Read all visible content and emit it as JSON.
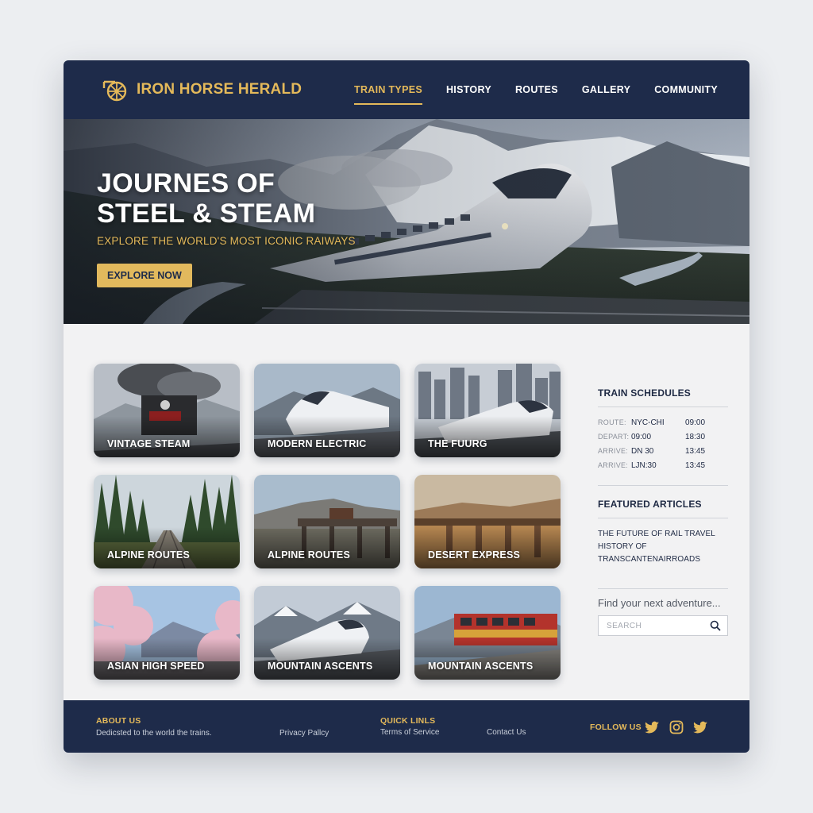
{
  "brand": {
    "name": "IRON HORSE HERALD",
    "logo": "train-wheel-icon"
  },
  "nav": {
    "items": [
      {
        "label": "TRAIN TYPES",
        "active": true
      },
      {
        "label": "HISTORY",
        "active": false
      },
      {
        "label": "ROUTES",
        "active": false
      },
      {
        "label": "GALLERY",
        "active": false
      },
      {
        "label": "COMMUNITY",
        "active": false
      }
    ]
  },
  "hero": {
    "title": "JOURNES OF\nSTEEL & STEAM",
    "subtitle": "EXPLORE THE WORLD'S MOST ICONIC RAIWAYS",
    "cta": "EXPLORE NOW"
  },
  "cards": [
    {
      "label": "VINTAGE STEAM"
    },
    {
      "label": "MODERN ELECTRIC"
    },
    {
      "label": "THE FUURG"
    },
    {
      "label": "ALPINE ROUTES"
    },
    {
      "label": "ALPINE ROUTES"
    },
    {
      "label": "DESERT EXPRESS"
    },
    {
      "label": "ASIAN HIGH SPEED"
    },
    {
      "label": "MOUNTAIN ASCENTS"
    },
    {
      "label": "MOUNTAIN ASCENTS"
    }
  ],
  "sidebar": {
    "schedules_title": "TRAIN SCHEDULES",
    "schedule": [
      {
        "key": "ROUTE:",
        "a": "NYC-CHI",
        "b": "09:00"
      },
      {
        "key": "DEPART:",
        "a": "09:00",
        "b": "18:30"
      },
      {
        "key": "ARRIVE:",
        "a": "DN 30",
        "b": "13:45"
      },
      {
        "key": "ARRIVE:",
        "a": "LJN:30",
        "b": "13:45"
      }
    ],
    "articles_title": "FEATURED ARTICLES",
    "articles": [
      "THE FUTURE OF RAIL TRAVEL",
      "HISTORY OF TRANSCANTENAIRROADS"
    ],
    "find_text": "Find your next adventure...",
    "search_placeholder": "SEARCH"
  },
  "footer": {
    "about_title": "ABOUT US",
    "about_text": "Dedicsted to the world the trains.",
    "privacy": "Privacy Pallcy",
    "quick_title": "QUICK LINLS",
    "terms": "Terms of Service",
    "contact": "Contact Us",
    "follow_title": "FOLLOW US",
    "social": [
      "twitter-icon",
      "instagram-icon",
      "twitter-icon"
    ]
  },
  "colors": {
    "navy": "#1e2b4a",
    "gold": "#e4b95a",
    "button_gold": "#e2b95d",
    "page_bg": "#f2f2f3"
  }
}
